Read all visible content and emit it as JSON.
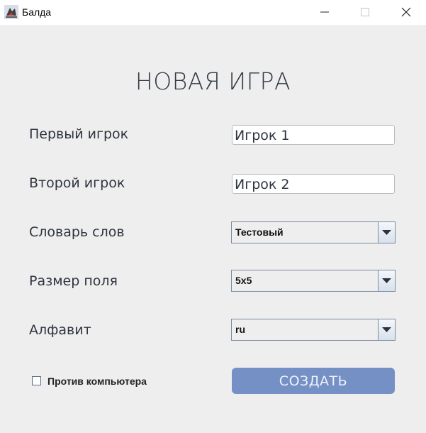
{
  "window": {
    "title": "Балда",
    "icons": [
      "app-icon",
      "minimize-icon",
      "maximize-icon",
      "close-icon"
    ]
  },
  "form": {
    "heading": "НОВАЯ ИГРА",
    "first_player": {
      "label": "Первый игрок",
      "value": "Игрок 1"
    },
    "second_player": {
      "label": "Второй игрок",
      "value": "Игрок 2"
    },
    "dictionary": {
      "label": "Словарь слов",
      "selected": "Тестовый"
    },
    "field_size": {
      "label": "Размер поля",
      "selected": "5x5"
    },
    "alphabet": {
      "label": "Алфавит",
      "selected": "ru"
    },
    "vs_computer": {
      "label": "Против компьютера",
      "checked": false
    },
    "create_button": "СОЗДАТЬ"
  },
  "colors": {
    "background": "#eeeeee",
    "button": "#7590c4",
    "button_text": "#eef2fa"
  }
}
